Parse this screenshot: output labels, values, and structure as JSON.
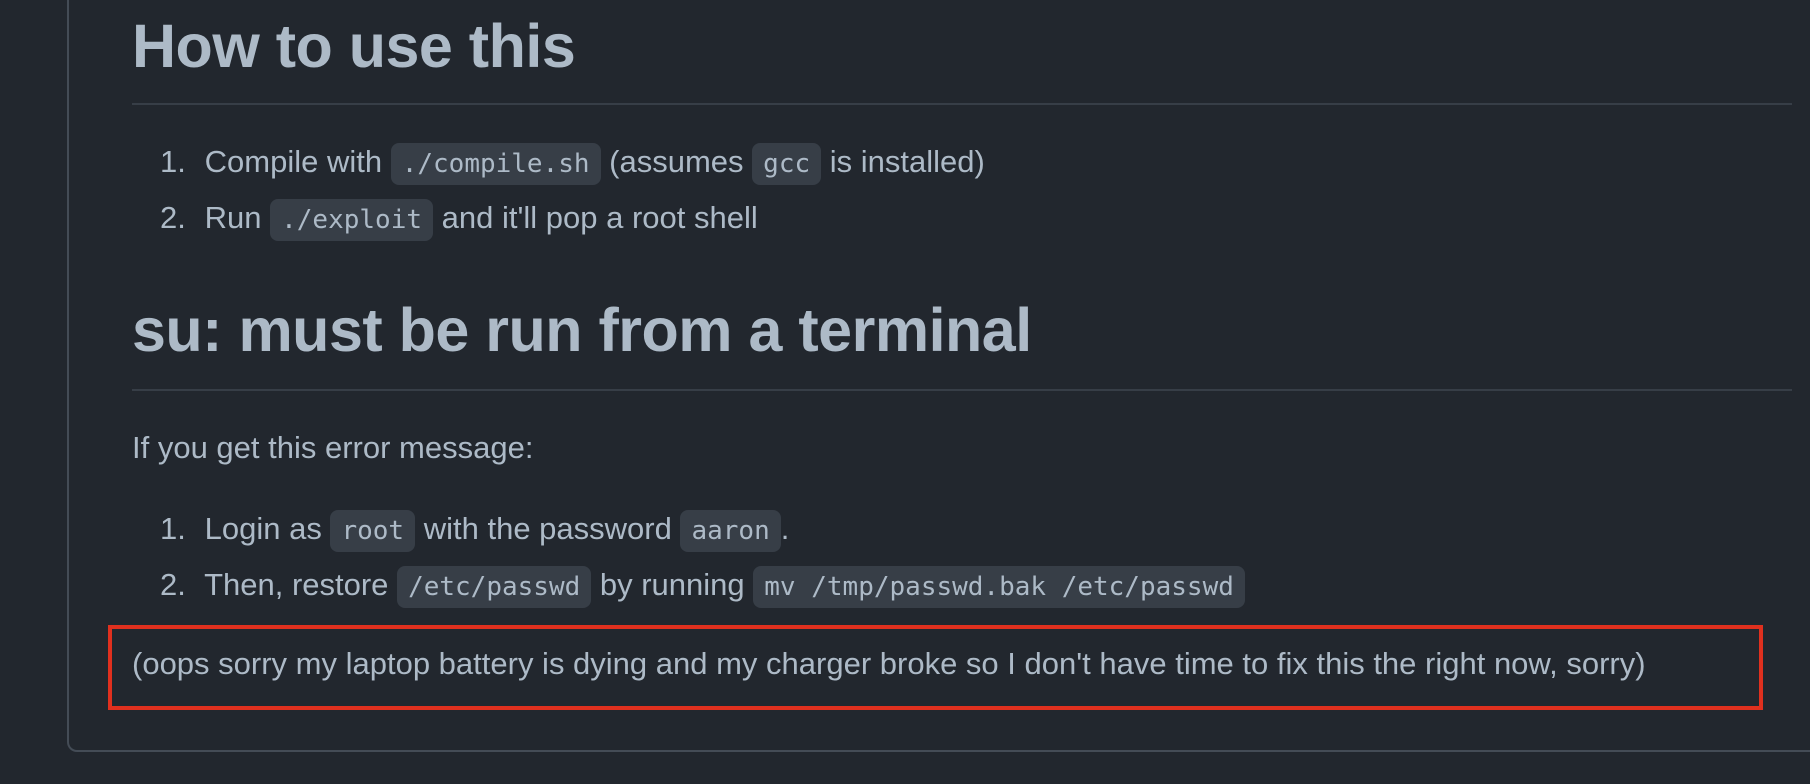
{
  "section1": {
    "heading": "How to use this",
    "steps": [
      {
        "num": "1.",
        "pre": "Compile with",
        "code1": "./compile.sh",
        "mid": "(assumes",
        "code2": "gcc",
        "post": "is installed)"
      },
      {
        "num": "2.",
        "pre": "Run",
        "code1": "./exploit",
        "post": "and it'll pop a root shell"
      }
    ]
  },
  "section2": {
    "heading": "su: must be run from a terminal",
    "intro": "If you get this error message:",
    "steps": [
      {
        "num": "1.",
        "pre": "Login as",
        "code1": "root",
        "mid": "with the password",
        "code2": "aaron",
        "post": "."
      },
      {
        "num": "2.",
        "pre": "Then, restore",
        "code1": "/etc/passwd",
        "mid": "by running",
        "code2": "mv /tmp/passwd.bak /etc/passwd"
      }
    ]
  },
  "note": "(oops sorry my laptop battery is dying and my charger broke so I don't have time to fix this the right now, sorry)",
  "colors": {
    "background": "#22272e",
    "text": "#adbac7",
    "code_background": "#373e47",
    "highlight_border": "#e0301e"
  }
}
